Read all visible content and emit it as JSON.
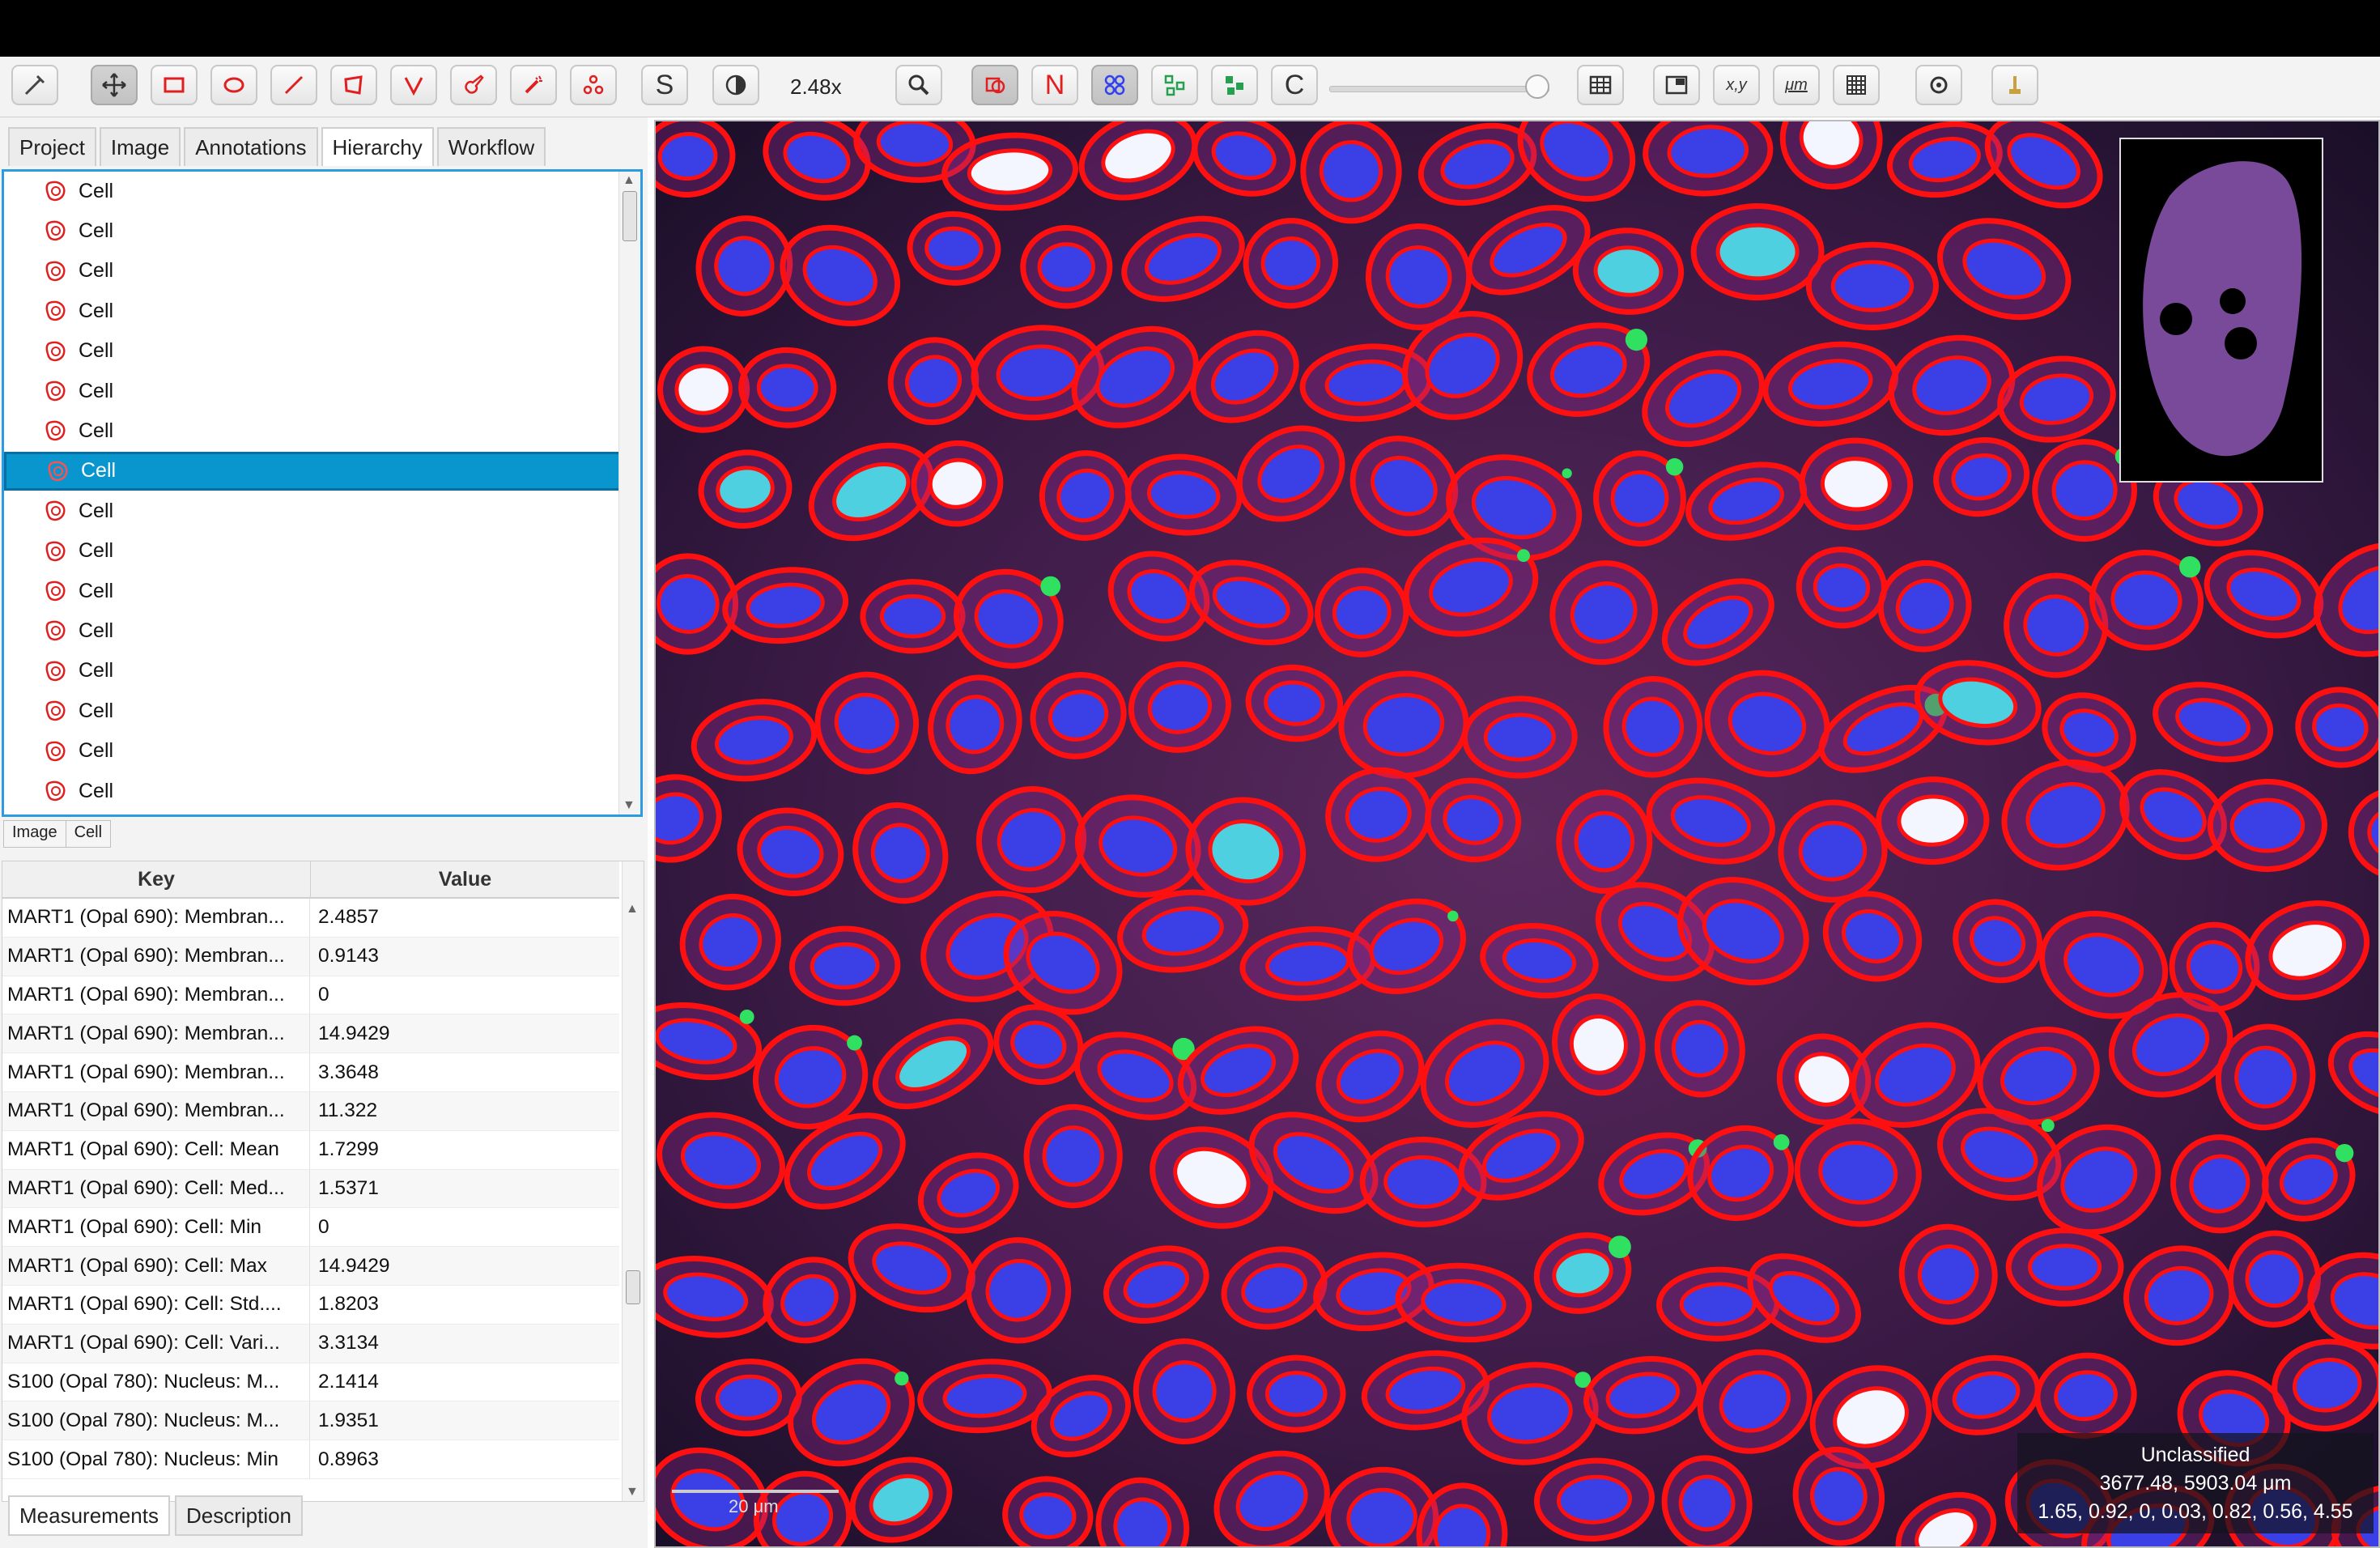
{
  "toolbar": {
    "zoom": "2.48x",
    "text_tool_label": "S",
    "n_label": "N",
    "c_label": "C",
    "xy_label": "x,y",
    "um_label": "μm",
    "icons": [
      "move-icon",
      "pan-icon",
      "rectangle-icon",
      "ellipse-icon",
      "line-icon",
      "polygon-icon",
      "polyline-icon",
      "brush-icon",
      "wand-icon",
      "points-icon",
      "selection-mode-icon",
      "brightness-contrast-icon",
      "zoom-to-fit-icon",
      "show-annotations-icon",
      "fill-detections-icon",
      "show-tma-grid-icon",
      "detections-icon",
      "view-table-icon",
      "overview-icon",
      "cell-measure-icon",
      "scalebar-toggle-icon",
      "grid-icon",
      "settings-icon",
      "pipette-icon"
    ]
  },
  "tabs": [
    "Project",
    "Image",
    "Annotations",
    "Hierarchy",
    "Workflow"
  ],
  "active_tab": "Hierarchy",
  "hierarchy": {
    "items": [
      "Cell",
      "Cell",
      "Cell",
      "Cell",
      "Cell",
      "Cell",
      "Cell",
      "Cell",
      "Cell",
      "Cell",
      "Cell",
      "Cell",
      "Cell",
      "Cell",
      "Cell",
      "Cell"
    ],
    "selected_index": 7,
    "breadcrumb": [
      "Image",
      "Cell"
    ]
  },
  "measurements": {
    "headers": {
      "key": "Key",
      "value": "Value"
    },
    "rows": [
      {
        "key": "MART1 (Opal 690): Membran...",
        "value": "2.4857"
      },
      {
        "key": "MART1 (Opal 690): Membran...",
        "value": "0.9143"
      },
      {
        "key": "MART1 (Opal 690): Membran...",
        "value": "0"
      },
      {
        "key": "MART1 (Opal 690): Membran...",
        "value": "14.9429"
      },
      {
        "key": "MART1 (Opal 690): Membran...",
        "value": "3.3648"
      },
      {
        "key": "MART1 (Opal 690): Membran...",
        "value": "11.322"
      },
      {
        "key": "MART1 (Opal 690): Cell: Mean",
        "value": "1.7299"
      },
      {
        "key": "MART1 (Opal 690): Cell: Med...",
        "value": "1.5371"
      },
      {
        "key": "MART1 (Opal 690): Cell: Min",
        "value": "0"
      },
      {
        "key": "MART1 (Opal 690): Cell: Max",
        "value": "14.9429"
      },
      {
        "key": "MART1 (Opal 690): Cell: Std....",
        "value": "1.8203"
      },
      {
        "key": "MART1 (Opal 690): Cell: Vari...",
        "value": "3.3134"
      },
      {
        "key": "S100 (Opal 780): Nucleus: M...",
        "value": "2.1414"
      },
      {
        "key": "S100 (Opal 780): Nucleus: M...",
        "value": "1.9351"
      },
      {
        "key": "S100 (Opal 780): Nucleus: Min",
        "value": "0.8963"
      }
    ]
  },
  "bottom_tabs": [
    "Measurements",
    "Description"
  ],
  "active_bottom_tab": "Measurements",
  "viewer": {
    "scalebar_label": "20 μm",
    "info_class": "Unclassified",
    "info_coords": "3677.48, 5903.04 μm",
    "info_values": "1.65, 0.92, 0, 0.03, 0.82, 0.56, 4.55"
  },
  "colors": {
    "outline": "#ff1010",
    "selection": "#0996ce",
    "nucleus": "#3a3fe6",
    "background_tissue": "#5a2a5e"
  }
}
